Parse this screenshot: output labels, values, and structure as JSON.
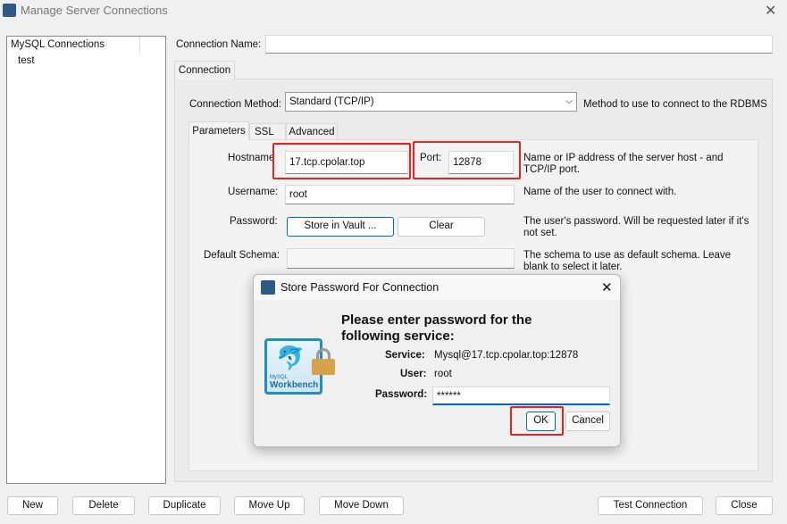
{
  "window": {
    "title": "Manage Server Connections",
    "close_icon": "close-icon"
  },
  "tree": {
    "header": "MySQL Connections",
    "items": [
      "test"
    ]
  },
  "form": {
    "connection_name_label": "Connection Name:",
    "connection_name_value": "",
    "tab_connection": "Connection",
    "method_label": "Connection Method:",
    "method_value": "Standard (TCP/IP)",
    "method_desc": "Method to use to connect to the RDBMS",
    "subtabs": [
      "Parameters",
      "SSL",
      "Advanced"
    ],
    "hostname_label": "Hostname",
    "hostname_value": "17.tcp.cpolar.top",
    "port_label": "Port:",
    "port_value": "12878",
    "hostname_desc": "Name or IP address of the server host - and TCP/IP port.",
    "username_label": "Username:",
    "username_value": "root",
    "username_desc": "Name of the user to connect with.",
    "password_label": "Password:",
    "store_vault": "Store in Vault ...",
    "clear": "Clear",
    "password_desc": "The user's password. Will be requested later if it's not set.",
    "schema_label": "Default Schema:",
    "schema_value": "",
    "schema_desc": "The schema to use as default schema. Leave blank to select it later."
  },
  "dialog": {
    "title": "Store Password For Connection",
    "heading": "Please enter password for the following service:",
    "service_label": "Service:",
    "service_value": "Mysql@17.tcp.cpolar.top:12878",
    "user_label": "User:",
    "user_value": "root",
    "password_label": "Password:",
    "password_value": "******",
    "ok": "OK",
    "cancel": "Cancel",
    "logo_text": "Workbench",
    "logo_small": "MySQL"
  },
  "footer": {
    "new": "New",
    "delete": "Delete",
    "duplicate": "Duplicate",
    "move_up": "Move Up",
    "move_down": "Move Down",
    "test": "Test Connection",
    "close": "Close"
  },
  "colors": {
    "highlight": "#f02020",
    "accent": "#0067c0"
  }
}
